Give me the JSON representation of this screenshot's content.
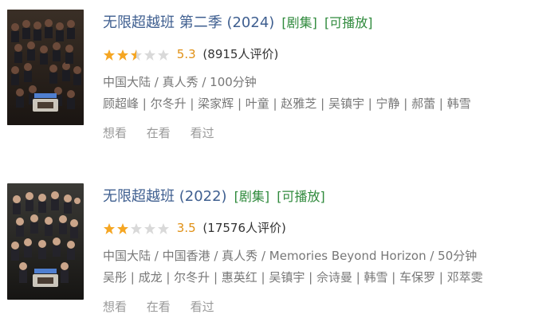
{
  "results": [
    {
      "title": "无限超越班 第二季 (2024)",
      "tags": [
        "[剧集]",
        "[可播放]"
      ],
      "rating": "5.3",
      "stars": 2.5,
      "rating_count": "(8915人评价)",
      "meta_line1": "中国大陆 / 真人秀 / 100分钟",
      "meta_line2": "顾超峰 | 尔冬升 | 梁家辉 | 叶童 | 赵雅芝 | 吴镇宇 | 宁静 | 郝蕾 | 韩雪",
      "actions": [
        "想看",
        "在看",
        "看过"
      ]
    },
    {
      "title": "无限超越班 (2022)",
      "tags": [
        "[剧集]",
        "[可播放]"
      ],
      "rating": "3.5",
      "stars": 2,
      "rating_count": "(17576人评价)",
      "meta_line1": "中国大陆 / 中国香港 / 真人秀 / Memories Beyond Horizon / 50分钟",
      "meta_line2": "吴彤 | 成龙 | 尔冬升 | 惠英红 | 吴镇宇 | 佘诗曼 | 韩雪 | 车保罗 | 邓萃雯",
      "actions": [
        "想看",
        "在看",
        "看过"
      ]
    }
  ],
  "colors": {
    "title": "#3f5f90",
    "tag": "#2f8a3c",
    "score": "#e09015",
    "star_filled": "#f5a623",
    "star_empty": "#d9d9d9",
    "meta": "#777777",
    "action": "#999999"
  }
}
